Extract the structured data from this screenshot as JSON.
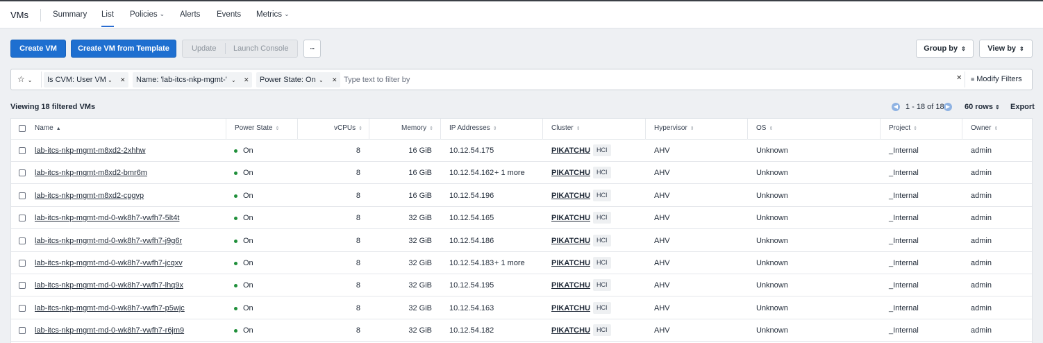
{
  "nav": {
    "title": "VMs",
    "tabs": [
      {
        "label": "Summary",
        "active": false
      },
      {
        "label": "List",
        "active": true
      },
      {
        "label": "Policies",
        "active": false
      },
      {
        "label": "Alerts",
        "active": false
      },
      {
        "label": "Events",
        "active": false
      },
      {
        "label": "Metrics",
        "active": false
      }
    ]
  },
  "toolbar": {
    "create_vm": "Create VM",
    "create_from_template": "Create VM from Template",
    "update": "Update",
    "launch_console": "Launch Console",
    "more": "···",
    "group_by": "Group by",
    "view_by": "View by"
  },
  "filters": {
    "chips": [
      "Is CVM: User VM",
      "Name: 'lab-itcs-nkp-mgmt-'",
      "Power State: On"
    ],
    "placeholder": "Type text to filter by",
    "modify": "Modify Filters"
  },
  "summary": {
    "viewing": "Viewing 18 filtered VMs",
    "range": "1 - 18 of 18",
    "rows": "60 rows",
    "export": "Export"
  },
  "table": {
    "headers": [
      "Name",
      "Power State",
      "vCPUs",
      "Memory",
      "IP Addresses",
      "Cluster",
      "Hypervisor",
      "OS",
      "Project",
      "Owner"
    ],
    "rows": [
      {
        "name": "lab-itcs-nkp-mgmt-m8xd2-2xhhw",
        "power": "On",
        "vcpus": "8",
        "memory": "16 GiB",
        "ip": "10.12.54.175",
        "more": "",
        "cluster": "PIKATCHU",
        "tag": "HCI",
        "hypervisor": "AHV",
        "os": "Unknown",
        "project": "_Internal",
        "owner": "admin"
      },
      {
        "name": "lab-itcs-nkp-mgmt-m8xd2-bmr6m",
        "power": "On",
        "vcpus": "8",
        "memory": "16 GiB",
        "ip": "10.12.54.162",
        "more": "+ 1 more",
        "cluster": "PIKATCHU",
        "tag": "HCI",
        "hypervisor": "AHV",
        "os": "Unknown",
        "project": "_Internal",
        "owner": "admin"
      },
      {
        "name": "lab-itcs-nkp-mgmt-m8xd2-cpgvp",
        "power": "On",
        "vcpus": "8",
        "memory": "16 GiB",
        "ip": "10.12.54.196",
        "more": "",
        "cluster": "PIKATCHU",
        "tag": "HCI",
        "hypervisor": "AHV",
        "os": "Unknown",
        "project": "_Internal",
        "owner": "admin"
      },
      {
        "name": "lab-itcs-nkp-mgmt-md-0-wk8h7-vwfh7-5lt4t",
        "power": "On",
        "vcpus": "8",
        "memory": "32 GiB",
        "ip": "10.12.54.165",
        "more": "",
        "cluster": "PIKATCHU",
        "tag": "HCI",
        "hypervisor": "AHV",
        "os": "Unknown",
        "project": "_Internal",
        "owner": "admin"
      },
      {
        "name": "lab-itcs-nkp-mgmt-md-0-wk8h7-vwfh7-j9g6r",
        "power": "On",
        "vcpus": "8",
        "memory": "32 GiB",
        "ip": "10.12.54.186",
        "more": "",
        "cluster": "PIKATCHU",
        "tag": "HCI",
        "hypervisor": "AHV",
        "os": "Unknown",
        "project": "_Internal",
        "owner": "admin"
      },
      {
        "name": "lab-itcs-nkp-mgmt-md-0-wk8h7-vwfh7-jcqxv",
        "power": "On",
        "vcpus": "8",
        "memory": "32 GiB",
        "ip": "10.12.54.183",
        "more": "+ 1 more",
        "cluster": "PIKATCHU",
        "tag": "HCI",
        "hypervisor": "AHV",
        "os": "Unknown",
        "project": "_Internal",
        "owner": "admin"
      },
      {
        "name": "lab-itcs-nkp-mgmt-md-0-wk8h7-vwfh7-lhq9x",
        "power": "On",
        "vcpus": "8",
        "memory": "32 GiB",
        "ip": "10.12.54.195",
        "more": "",
        "cluster": "PIKATCHU",
        "tag": "HCI",
        "hypervisor": "AHV",
        "os": "Unknown",
        "project": "_Internal",
        "owner": "admin"
      },
      {
        "name": "lab-itcs-nkp-mgmt-md-0-wk8h7-vwfh7-p5wjc",
        "power": "On",
        "vcpus": "8",
        "memory": "32 GiB",
        "ip": "10.12.54.163",
        "more": "",
        "cluster": "PIKATCHU",
        "tag": "HCI",
        "hypervisor": "AHV",
        "os": "Unknown",
        "project": "_Internal",
        "owner": "admin"
      },
      {
        "name": "lab-itcs-nkp-mgmt-md-0-wk8h7-vwfh7-r6jm9",
        "power": "On",
        "vcpus": "8",
        "memory": "32 GiB",
        "ip": "10.12.54.182",
        "more": "",
        "cluster": "PIKATCHU",
        "tag": "HCI",
        "hypervisor": "AHV",
        "os": "Unknown",
        "project": "_Internal",
        "owner": "admin"
      }
    ]
  },
  "colors": {
    "accent": "#1e6fd0",
    "status_on": "#1f8f3a"
  }
}
